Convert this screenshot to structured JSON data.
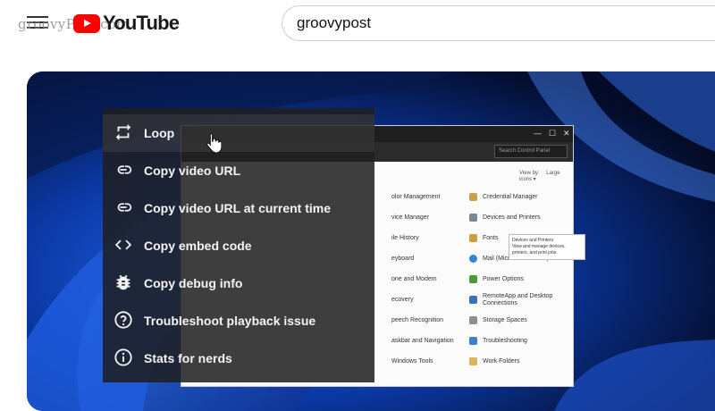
{
  "header": {
    "watermark": "groovyPost.com",
    "logo_text": "YouTube",
    "search_value": "groovypost"
  },
  "video": {
    "control_panel": {
      "search_placeholder": "Search Control Panel",
      "view_by_label": "View by:",
      "view_by_value": "Large icons ▾",
      "items_left": [
        "olor Management",
        "vice Manager",
        "ile History",
        "eyboard",
        "one and Modem",
        "ecovery",
        "peech Recognition",
        "askbar and Navigation",
        "Windows Tools"
      ],
      "items_right": [
        "Credential Manager",
        "Devices and Printers",
        "Fonts",
        "Mail (Microsoft Outlook)",
        "Power Options",
        "RemoteApp and Desktop Connections",
        "Storage Spaces",
        "Troubleshooting",
        "Work Folders"
      ],
      "tooltip_title": "Devices and Printers",
      "tooltip_text": "View and manage devices, printers, and print jobs"
    }
  },
  "context_menu": {
    "items": [
      {
        "label": "Loop",
        "icon": "loop-icon"
      },
      {
        "label": "Copy video URL",
        "icon": "link-icon"
      },
      {
        "label": "Copy video URL at current time",
        "icon": "link-icon"
      },
      {
        "label": "Copy embed code",
        "icon": "code-icon"
      },
      {
        "label": "Copy debug info",
        "icon": "bug-icon"
      },
      {
        "label": "Troubleshoot playback issue",
        "icon": "help-icon"
      },
      {
        "label": "Stats for nerds",
        "icon": "info-icon"
      }
    ]
  },
  "colors": {
    "youtube_red": "#ff0000",
    "menu_bg": "#1e1e1e",
    "video_bg": "#05112e"
  }
}
